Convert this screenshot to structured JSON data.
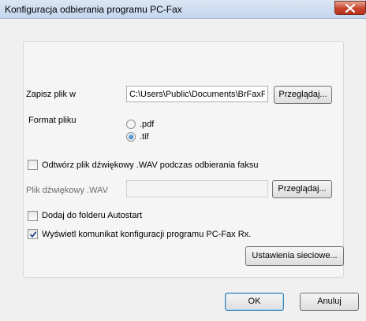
{
  "window": {
    "title": "Konfiguracja odbierania programu PC-Fax"
  },
  "icons": {
    "close": "close-icon",
    "checkmark": "checkmark-icon"
  },
  "save": {
    "label": "Zapisz plik w",
    "path": "C:\\Users\\Public\\Documents\\BrFaxF",
    "browse_label": "Przeglądaj..."
  },
  "format": {
    "label": "Format pliku",
    "options": [
      {
        "label": ".pdf",
        "selected": false
      },
      {
        "label": ".tif",
        "selected": true
      }
    ]
  },
  "wav": {
    "checkbox_label": "Odtwórz plik dźwiękowy .WAV podczas odbierania faksu",
    "checked": false,
    "file_label": "Plik dźwiękowy .WAV",
    "file_value": "",
    "browse_label": "Przeglądaj..."
  },
  "autostart": {
    "label": "Dodaj do folderu Autostart",
    "checked": false
  },
  "show_message": {
    "label": "Wyświetl komunikat konfiguracji programu PC-Fax Rx.",
    "checked": true
  },
  "network_button": "Ustawienia sieciowe...",
  "buttons": {
    "ok": "OK",
    "cancel": "Anuluj"
  },
  "colors": {
    "close_button": "#c7452b",
    "title_bar": "#c4d6ee",
    "default_button_border": "#3c7fb1"
  }
}
